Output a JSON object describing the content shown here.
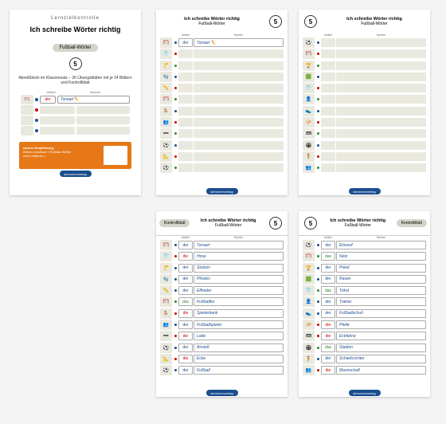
{
  "cover": {
    "topLabel": "Lernzielkontrolle",
    "title": "Ich schreibe Wörter richtig",
    "subtitle": "Fußball-Wörter",
    "number": "5",
    "description": "Abreißblock im Klassensatz –\n30 Übungsblätter mit je 24 Bildern\nund Kontrollblatt",
    "headers": {
      "artikel": "Artikel",
      "nomen": "Nomen"
    },
    "sample": {
      "artikel": "der",
      "nomen": "Torwart"
    },
    "promo": {
      "label": "Unsere Empfehlung:",
      "text": "Meine Lesedose 9\nFußball-Wörter",
      "link": "mehr erfahren »"
    },
    "publisher": "sternchenverlag"
  },
  "worksheets": {
    "title": "Ich schreibe Wörter richtig",
    "subtitle": "Fußball-Wörter",
    "number": "5",
    "kontrollblatt": "Kontrollblatt",
    "headers": {
      "artikel": "Artikel",
      "nomen": "Nomen"
    },
    "icons1": [
      "🥅",
      "👕",
      "🦵",
      "🧤",
      "📏",
      "🥅",
      "🪑",
      "👥",
      "➖",
      "⚽",
      "📐",
      "⚽"
    ],
    "icons2": [
      "⚽",
      "🥅",
      "🏆",
      "🟩",
      "👕",
      "👤",
      "👟",
      "📯",
      "🎟",
      "🏟",
      "🧍",
      "👥"
    ],
    "sample": {
      "artikel": "der",
      "artikelClass": "ar-b",
      "nomen": "Torwart",
      "dot": "db",
      "icon": "🥅"
    },
    "kb1": [
      {
        "i": "🥅",
        "d": "db",
        "a": "der",
        "ac": "ar-b",
        "n": "Torwart"
      },
      {
        "i": "👕",
        "d": "dr",
        "a": "die",
        "ac": "ar-r",
        "n": "Hose"
      },
      {
        "i": "🦵",
        "d": "db",
        "a": "der",
        "ac": "ar-b",
        "n": "Stutzen"
      },
      {
        "i": "🧤",
        "d": "db",
        "a": "der",
        "ac": "ar-b",
        "n": "Pfosten"
      },
      {
        "i": "📏",
        "d": "db",
        "a": "der",
        "ac": "ar-b",
        "n": "Elfmeter"
      },
      {
        "i": "🥅",
        "d": "dg",
        "a": "das",
        "ac": "ar-g",
        "n": "Fußballtor"
      },
      {
        "i": "🪑",
        "d": "dr",
        "a": "die",
        "ac": "ar-r",
        "n": "Spielerbank"
      },
      {
        "i": "👥",
        "d": "db",
        "a": "der",
        "ac": "ar-b",
        "n": "Fußballspieler"
      },
      {
        "i": "➖",
        "d": "dr",
        "a": "die",
        "ac": "ar-r",
        "n": "Latte"
      },
      {
        "i": "⚽",
        "d": "db",
        "a": "der",
        "ac": "ar-b",
        "n": "Anstoß"
      },
      {
        "i": "📐",
        "d": "dr",
        "a": "die",
        "ac": "ar-r",
        "n": "Ecke"
      },
      {
        "i": "⚽",
        "d": "db",
        "a": "der",
        "ac": "ar-b",
        "n": "Fußball"
      }
    ],
    "kb2": [
      {
        "i": "⚽",
        "d": "db",
        "a": "der",
        "ac": "ar-b",
        "n": "Einwurf"
      },
      {
        "i": "🥅",
        "d": "dg",
        "a": "das",
        "ac": "ar-g",
        "n": "Netz"
      },
      {
        "i": "🏆",
        "d": "db",
        "a": "der",
        "ac": "ar-b",
        "n": "Pokal"
      },
      {
        "i": "🟩",
        "d": "db",
        "a": "der",
        "ac": "ar-b",
        "n": "Rasen"
      },
      {
        "i": "👕",
        "d": "dg",
        "a": "das",
        "ac": "ar-g",
        "n": "Trikot"
      },
      {
        "i": "👤",
        "d": "db",
        "a": "der",
        "ac": "ar-b",
        "n": "Trainer"
      },
      {
        "i": "👟",
        "d": "db",
        "a": "der",
        "ac": "ar-b",
        "n": "Fußballschuh"
      },
      {
        "i": "📯",
        "d": "dr",
        "a": "die",
        "ac": "ar-r",
        "n": "Pfeife"
      },
      {
        "i": "🎟",
        "d": "dr",
        "a": "die",
        "ac": "ar-r",
        "n": "Eckfahne"
      },
      {
        "i": "🏟",
        "d": "dg",
        "a": "das",
        "ac": "ar-g",
        "n": "Stadion"
      },
      {
        "i": "🧍",
        "d": "db",
        "a": "der",
        "ac": "ar-b",
        "n": "Schiedsrichter"
      },
      {
        "i": "👥",
        "d": "dr",
        "a": "die",
        "ac": "ar-r",
        "n": "Mannschaft"
      }
    ]
  }
}
